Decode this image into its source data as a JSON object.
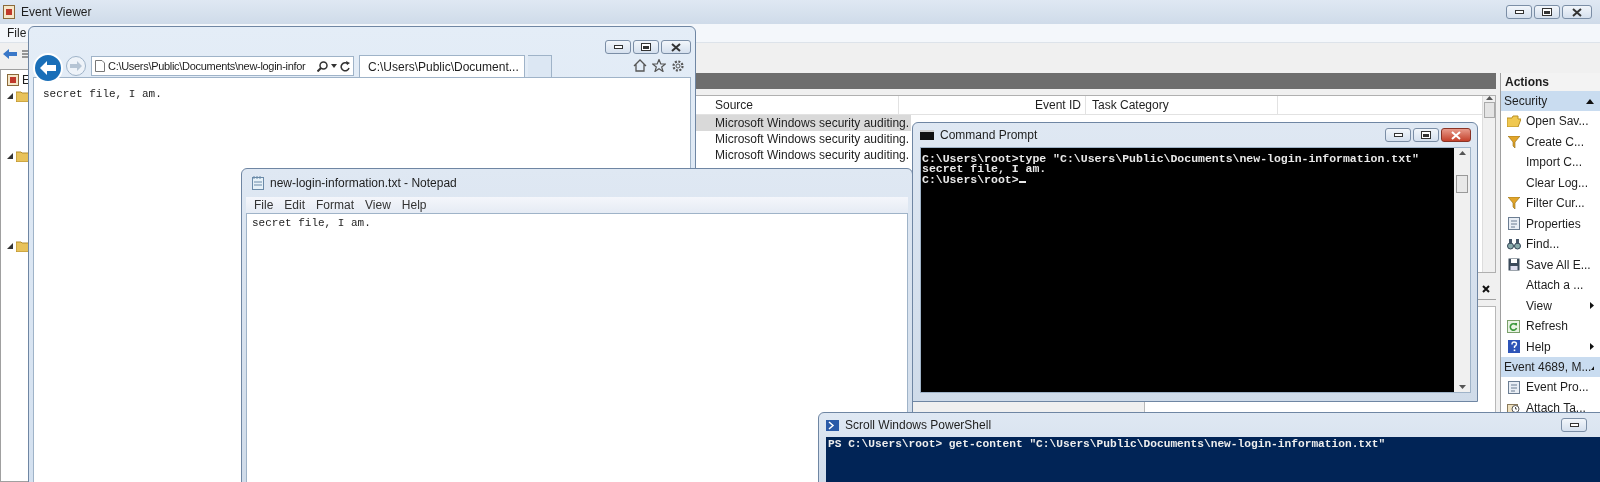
{
  "event_viewer": {
    "title": "Event Viewer",
    "menu": [
      "File"
    ],
    "tree": [
      {
        "label": "E"
      }
    ],
    "columns": [
      "Source",
      "Event ID",
      "Task Category"
    ],
    "rows": [
      {
        "source": "Microsoft Windows security auditing.",
        "selected": true
      },
      {
        "source": "Microsoft Windows security auditing.",
        "selected": false
      },
      {
        "source": "Microsoft Windows security auditing.",
        "selected": false
      }
    ],
    "actions": {
      "title": "Actions",
      "groups": [
        {
          "label": "Security",
          "expanded": true,
          "items": [
            {
              "label": "Open Sav...",
              "kind": "open"
            },
            {
              "label": "Create C...",
              "kind": "filter"
            },
            {
              "label": "Import C...",
              "kind": "plain"
            },
            {
              "label": "Clear Log...",
              "kind": "plain"
            },
            {
              "label": "Filter Cur...",
              "kind": "filter"
            },
            {
              "label": "Properties",
              "kind": "properties"
            },
            {
              "label": "Find...",
              "kind": "find"
            },
            {
              "label": "Save All E...",
              "kind": "save"
            },
            {
              "label": "Attach a ...",
              "kind": "plain"
            },
            {
              "label": "View",
              "kind": "submenu"
            },
            {
              "label": "Refresh",
              "kind": "refresh"
            },
            {
              "label": "Help",
              "kind": "help"
            }
          ]
        },
        {
          "label": "Event 4689, M...",
          "expanded": true,
          "items": [
            {
              "label": "Event Pro...",
              "kind": "properties"
            },
            {
              "label": "Attach Ta...",
              "kind": "task"
            }
          ]
        }
      ]
    }
  },
  "browser": {
    "address": "C:\\Users\\Public\\Documents\\new-login-infor",
    "tabs": [
      {
        "label": "C:\\Users\\Public\\Document...",
        "selected": true
      }
    ],
    "content": "secret file, I am."
  },
  "notepad": {
    "title": "new-login-information.txt - Notepad",
    "menu": [
      "File",
      "Edit",
      "Format",
      "View",
      "Help"
    ],
    "content": "secret file, I am."
  },
  "cmd": {
    "title": "Command Prompt",
    "lines": [
      "C:\\Users\\root>type \"C:\\Users\\Public\\Documents\\new-login-information.txt\"",
      "secret file, I am.",
      "C:\\Users\\root>"
    ]
  },
  "powershell": {
    "title": "Scroll Windows PowerShell",
    "lines": [
      "PS C:\\Users\\root> get-content \"C:\\Users\\Public\\Documents\\new-login-information.txt\""
    ]
  }
}
